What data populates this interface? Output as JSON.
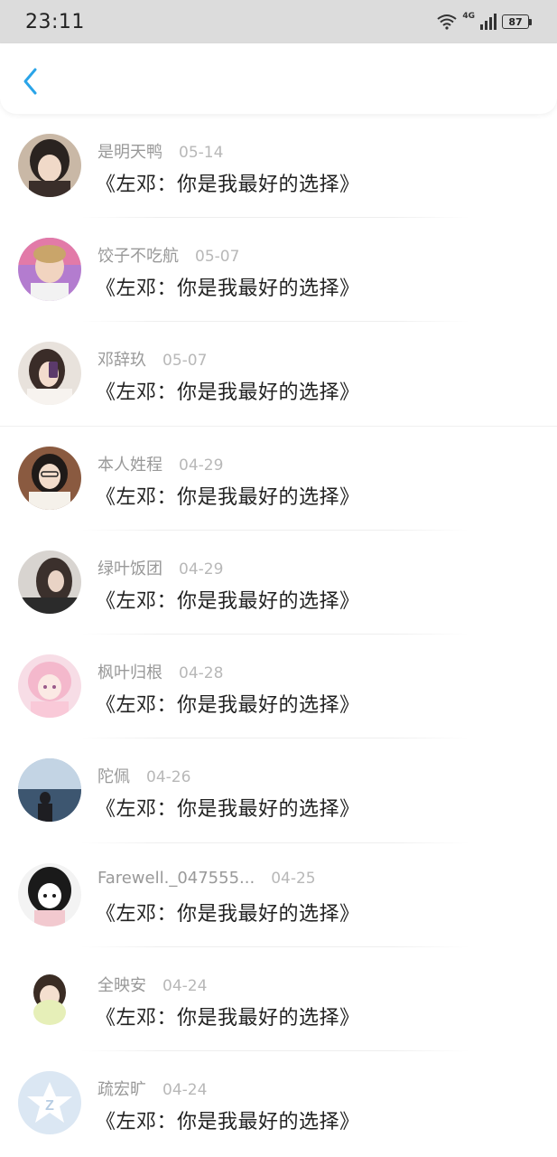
{
  "status_bar": {
    "time": "23:11",
    "network": "4G",
    "battery": "87"
  },
  "nav": {
    "back_icon": "chevron-left-icon",
    "accent_color": "#2aa4e8"
  },
  "items": [
    {
      "name": "是明天鸭",
      "date": "05-14",
      "comment": "《左邓：你是我最好的选择》"
    },
    {
      "name": "饺子不吃航",
      "date": "05-07",
      "comment": "《左邓：你是我最好的选择》"
    },
    {
      "name": "邓辞玖",
      "date": "05-07",
      "comment": "《左邓：你是我最好的选择》"
    },
    {
      "name": "本人姓程",
      "date": "04-29",
      "comment": "《左邓：你是我最好的选择》"
    },
    {
      "name": "绿叶饭团",
      "date": "04-29",
      "comment": "《左邓：你是我最好的选择》"
    },
    {
      "name": "枫叶归根",
      "date": "04-28",
      "comment": "《左邓：你是我最好的选择》"
    },
    {
      "name": "陀佩",
      "date": "04-26",
      "comment": "《左邓：你是我最好的选择》"
    },
    {
      "name": "Farewell._047555...",
      "date": "04-25",
      "comment": "《左邓：你是我最好的选择》"
    },
    {
      "name": "全映安",
      "date": "04-24",
      "comment": "《左邓：你是我最好的选择》"
    },
    {
      "name": "疏宏旷",
      "date": "04-24",
      "comment": "《左邓：你是我最好的选择》"
    }
  ]
}
